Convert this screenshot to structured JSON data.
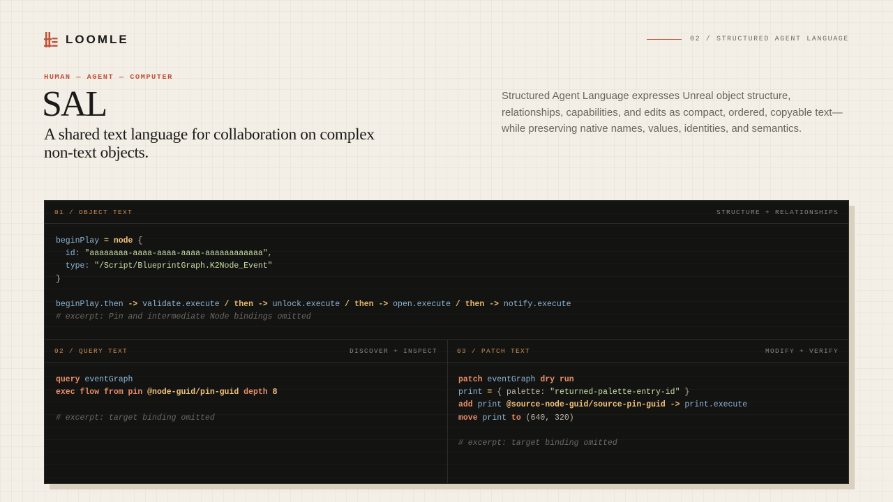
{
  "brand": {
    "name": "LOOMLE",
    "logo_icon": "loomle-mark-icon",
    "accent": "#c0533a"
  },
  "breadcrumb": {
    "text": "02 / STRUCTURED AGENT LANGUAGE"
  },
  "hero": {
    "eyebrow": "HUMAN — AGENT — COMPUTER",
    "title": "SAL",
    "subtitle": "A shared text language for collaboration on complex non-text objects.",
    "description": "Structured Agent Language expresses Unreal object structure, relationships, capabilities, and edits as compact, ordered, copyable text—while preserving native names, values, identities, and semantics."
  },
  "panels": {
    "object": {
      "label": "01 / OBJECT TEXT",
      "tag": "STRUCTURE + RELATIONSHIPS",
      "lines": [
        [
          {
            "t": "beginPlay",
            "c": "id"
          },
          {
            "t": " = ",
            "c": "kw"
          },
          {
            "t": "node",
            "c": "ref"
          },
          {
            "t": " {",
            "c": "pl"
          }
        ],
        [
          {
            "t": "  id: ",
            "c": "id"
          },
          {
            "t": "\"aaaaaaaa-aaaa-aaaa-aaaa-aaaaaaaaaaaa\"",
            "c": "str"
          },
          {
            "t": ",",
            "c": "pl"
          }
        ],
        [
          {
            "t": "  type: ",
            "c": "id"
          },
          {
            "t": "\"/Script/BlueprintGraph.K2Node_Event\"",
            "c": "str"
          }
        ],
        [
          {
            "t": "}",
            "c": "pl"
          }
        ],
        [
          {
            "t": "",
            "c": "pl"
          }
        ],
        [
          {
            "t": "beginPlay.then",
            "c": "id"
          },
          {
            "t": " -> ",
            "c": "kw"
          },
          {
            "t": "validate.execute",
            "c": "id"
          },
          {
            "t": " / ",
            "c": "kw"
          },
          {
            "t": "then",
            "c": "kw"
          },
          {
            "t": " -> ",
            "c": "kw"
          },
          {
            "t": "unlock.execute",
            "c": "id"
          },
          {
            "t": " / ",
            "c": "kw"
          },
          {
            "t": "then",
            "c": "kw"
          },
          {
            "t": " -> ",
            "c": "kw"
          },
          {
            "t": "open.execute",
            "c": "id"
          },
          {
            "t": " / ",
            "c": "kw"
          },
          {
            "t": "then",
            "c": "kw"
          },
          {
            "t": " -> ",
            "c": "kw"
          },
          {
            "t": "notify.execute",
            "c": "id"
          }
        ],
        [
          {
            "t": "# excerpt: Pin and intermediate Node bindings omitted",
            "c": "cm"
          }
        ]
      ]
    },
    "query": {
      "label": "02 / QUERY TEXT",
      "tag": "DISCOVER + INSPECT",
      "lines": [
        [
          {
            "t": "query",
            "c": "q"
          },
          {
            "t": " eventGraph",
            "c": "id"
          }
        ],
        [
          {
            "t": "exec flow from pin",
            "c": "q"
          },
          {
            "t": " ",
            "c": "pl"
          },
          {
            "t": "@node-guid/pin-guid",
            "c": "ref"
          },
          {
            "t": " depth",
            "c": "q"
          },
          {
            "t": " 8",
            "c": "ref"
          }
        ],
        [
          {
            "t": "",
            "c": "pl"
          }
        ],
        [
          {
            "t": "# excerpt: target binding omitted",
            "c": "cm"
          }
        ]
      ]
    },
    "patch": {
      "label": "03 / PATCH TEXT",
      "tag": "MODIFY + VERIFY",
      "lines": [
        [
          {
            "t": "patch",
            "c": "q"
          },
          {
            "t": " eventGraph ",
            "c": "id"
          },
          {
            "t": "dry run",
            "c": "q"
          }
        ],
        [
          {
            "t": "print",
            "c": "id"
          },
          {
            "t": " = ",
            "c": "kw"
          },
          {
            "t": "{ palette: ",
            "c": "pl"
          },
          {
            "t": "\"returned-palette-entry-id\"",
            "c": "str"
          },
          {
            "t": " }",
            "c": "pl"
          }
        ],
        [
          {
            "t": "add",
            "c": "q"
          },
          {
            "t": " print ",
            "c": "id"
          },
          {
            "t": "@source-node-guid/source-pin-guid",
            "c": "ref"
          },
          {
            "t": " -> ",
            "c": "kw"
          },
          {
            "t": "print.execute",
            "c": "id"
          }
        ],
        [
          {
            "t": "move",
            "c": "q"
          },
          {
            "t": " print ",
            "c": "id"
          },
          {
            "t": "to",
            "c": "q"
          },
          {
            "t": " (640, 320)",
            "c": "pl"
          }
        ],
        [
          {
            "t": "",
            "c": "pl"
          }
        ],
        [
          {
            "t": "# excerpt: target binding omitted",
            "c": "cm"
          }
        ]
      ]
    }
  }
}
